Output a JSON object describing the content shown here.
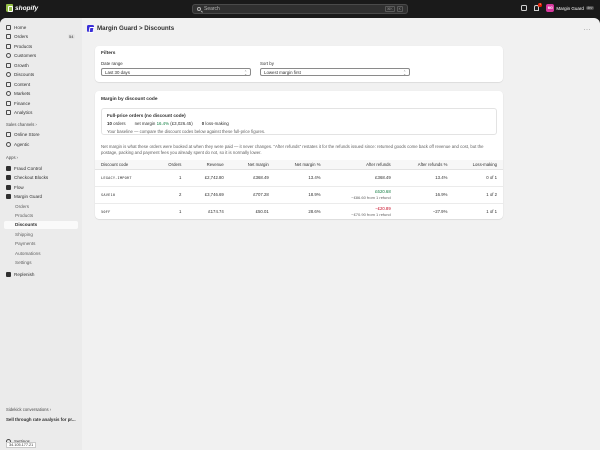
{
  "topbar": {
    "brand": "shopify",
    "search_placeholder": "Search",
    "shortcut_keys": [
      "⌘K",
      "K"
    ],
    "notification_count": "1",
    "store_initials": "MG",
    "store_name": "Margin Guard",
    "store_tag": "dev"
  },
  "sidebar": {
    "items": [
      {
        "label": "Home",
        "icon": "home-icon"
      },
      {
        "label": "Orders",
        "icon": "orders-icon",
        "badge": "54"
      },
      {
        "label": "Products",
        "icon": "tag-icon"
      },
      {
        "label": "Customers",
        "icon": "person-icon"
      },
      {
        "label": "Growth",
        "icon": "growth-icon"
      },
      {
        "label": "Discounts",
        "icon": "discount-icon"
      },
      {
        "label": "Content",
        "icon": "content-icon"
      },
      {
        "label": "Markets",
        "icon": "globe-icon"
      },
      {
        "label": "Finance",
        "icon": "bank-icon"
      },
      {
        "label": "Analytics",
        "icon": "chart-icon"
      }
    ],
    "sales_channels_label": "Sales channels",
    "sales_channels": [
      {
        "label": "Online Store",
        "icon": "store-icon"
      },
      {
        "label": "Agentic",
        "icon": "sparkle-icon"
      }
    ],
    "apps_label": "Apps",
    "apps": [
      {
        "label": "Fraud Control",
        "icon": "shield-icon"
      },
      {
        "label": "Checkout Blocks",
        "icon": "blocks-icon"
      },
      {
        "label": "Flow",
        "icon": "flow-icon"
      },
      {
        "label": "Margin Guard",
        "icon": "margin-guard-icon"
      }
    ],
    "app_subitems": [
      "Orders",
      "Products",
      "Discounts",
      "Shipping",
      "Payments",
      "Automations",
      "Settings"
    ],
    "replenish": {
      "label": "Replenish",
      "icon": "replenish-icon"
    },
    "sidekick_label": "Sidekick conversations",
    "sidekick_item": "Sell through rate analysis for pr...",
    "settings_label": "Settings",
    "ip_tag": "34.105.177.21"
  },
  "page": {
    "breadcrumb": "Margin Guard > Discounts"
  },
  "filters": {
    "title": "Filters",
    "date_range_label": "Date range",
    "date_range_value": "Last 30 days",
    "sort_by_label": "Sort by",
    "sort_by_value": "Lowest margin first"
  },
  "margin": {
    "title": "Margin by discount code",
    "full_price": {
      "title": "Full-price orders (no discount code)",
      "orders_count": "10",
      "orders_word": "orders",
      "net_margin_label": "net margin",
      "net_margin_pct": "16.4%",
      "net_margin_amount": "(£3,026.45)",
      "loss_making_count": "0",
      "loss_making_label": "loss-making",
      "note": "Your baseline — compare the discount codes below against these full-price figures."
    },
    "description": "Net margin is what these orders were booked at when they were paid — it never changes. \"After refunds\" restates it for the refunds issued since: returned goods come back off revenue and cost, but the postage, packing and payment fees you already spent do not, so it is normally lower.",
    "columns": [
      "Discount code",
      "Orders",
      "Revenue",
      "Net margin",
      "Net margin %",
      "After refunds",
      "After refunds %",
      "Loss-making"
    ],
    "rows": [
      {
        "code": "LEGACY-IMPORT",
        "orders": "1",
        "revenue": "£2,742.80",
        "net_margin": "£368.49",
        "net_margin_pct": "13.4%",
        "after_refunds": "£368.49",
        "after_refunds_note": "",
        "after_refunds_pct": "13.4%",
        "loss_making": "0 of 1"
      },
      {
        "code": "SAVE10",
        "orders": "2",
        "revenue": "£3,746.69",
        "net_margin": "£707.28",
        "net_margin_pct": "18.9%",
        "after_refunds": "£620.68",
        "after_refunds_note": "−£86.60 from 1 refund",
        "after_refunds_pct": "16.9%",
        "loss_making": "1 of 2"
      },
      {
        "code": "50FF",
        "orders": "1",
        "revenue": "£174.74",
        "net_margin": "£50.01",
        "net_margin_pct": "28.6%",
        "after_refunds": "−£20.89",
        "after_refunds_note": "−£70.90 from 1 refund",
        "after_refunds_pct": "−27.9%",
        "loss_making": "1 of 1"
      }
    ]
  },
  "colors": {
    "positive": "#0c7a3d",
    "negative": "#c70a24",
    "accent": "#3a2fd8"
  }
}
